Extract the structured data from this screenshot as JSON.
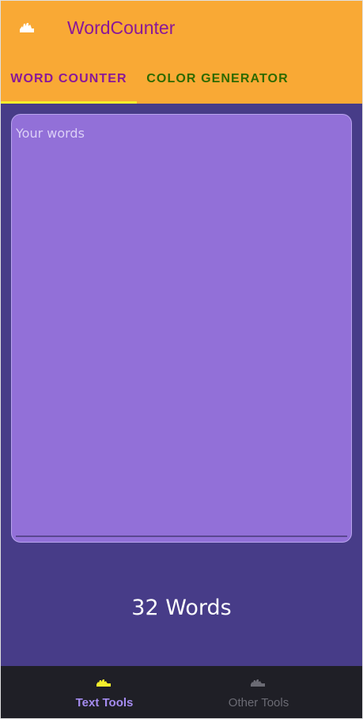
{
  "app": {
    "title": "WordCounter",
    "appbar_icon": "hand-icon"
  },
  "tabs": [
    {
      "label": "WORD COUNTER",
      "active": true
    },
    {
      "label": "COLOR GENERATOR",
      "active": false
    }
  ],
  "editor": {
    "placeholder": "Your words",
    "value": ""
  },
  "counter": {
    "text": "32 Words"
  },
  "bottom_nav": {
    "items": [
      {
        "label": "Text Tools",
        "icon": "hand-icon",
        "active": true
      },
      {
        "label": "Other Tools",
        "icon": "hand-icon",
        "active": false
      }
    ]
  },
  "colors": {
    "appbar": "#f9a935",
    "title": "#8a1898",
    "tab_inactive": "#2e6a00",
    "indicator": "#f5ee2c",
    "background": "#473c88",
    "editor_fill": "#9270d8",
    "bottom_nav": "#1f1f26",
    "nav_active": "#a58cf0",
    "nav_active_icon": "#f5ee2c",
    "nav_inactive": "#6b6b74"
  }
}
